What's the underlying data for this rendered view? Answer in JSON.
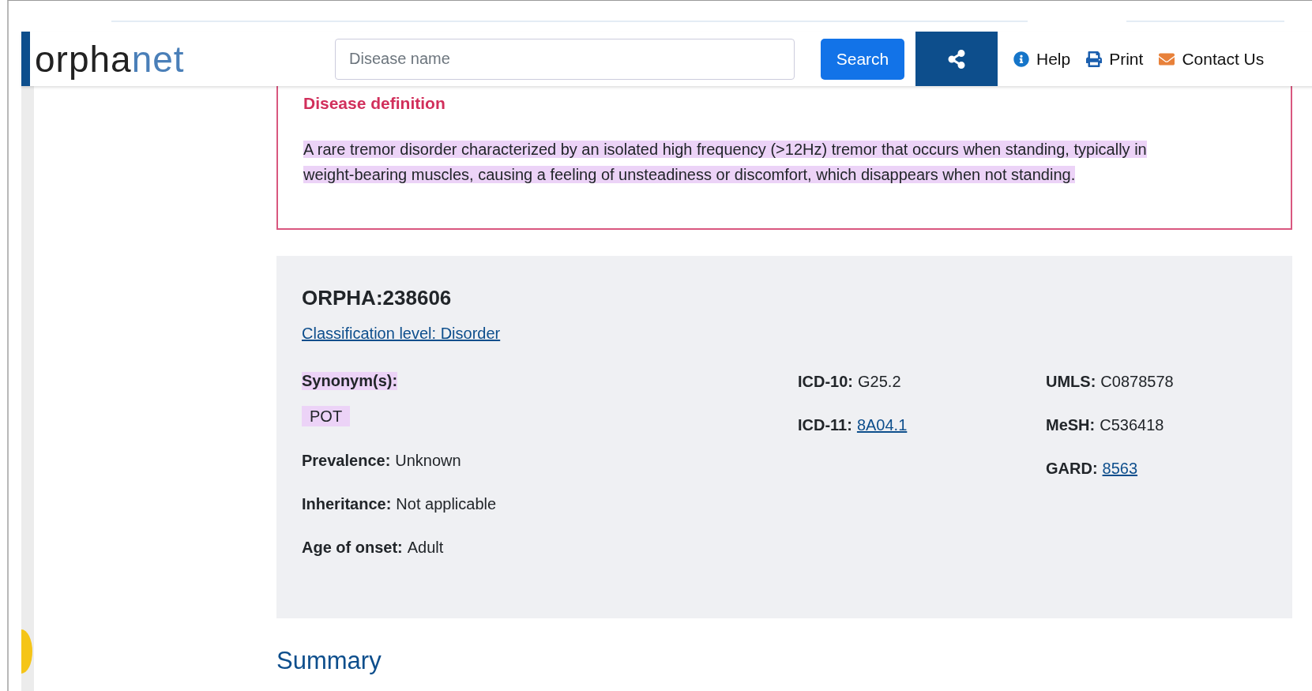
{
  "header": {
    "logo": {
      "first": "orpha",
      "second": "net"
    },
    "search": {
      "placeholder": "Disease name"
    },
    "search_button": "Search",
    "links": [
      {
        "kind": "help",
        "label": "Help"
      },
      {
        "kind": "print",
        "label": "Print"
      },
      {
        "kind": "contact",
        "label": "Contact Us"
      }
    ]
  },
  "definition": {
    "title": "Disease definition",
    "text": "A rare tremor disorder characterized by an isolated high frequency (>12Hz) tremor that occurs when standing, typically in weight-bearing muscles, causing a feeling of unsteadiness or discomfort, which disappears when not standing.",
    "highlighted": true
  },
  "record": {
    "id": "ORPHA:238606",
    "classification": "Classification level: Disorder",
    "synonyms": {
      "label": "Synonym(s):",
      "highlighted": true,
      "values": [
        {
          "text": "POT",
          "highlighted": true
        }
      ]
    },
    "fields": [
      {
        "label": "Prevalence:",
        "value": "Unknown"
      },
      {
        "label": "Inheritance:",
        "value": "Not applicable"
      },
      {
        "label": "Age of onset:",
        "value": "Adult"
      }
    ],
    "codes": [
      [
        {
          "label": "ICD-10:",
          "value": "G25.2",
          "link": false
        },
        {
          "label": "ICD-11:",
          "value": "8A04.1",
          "link": true
        }
      ],
      [
        {
          "label": "UMLS:",
          "value": "C0878578",
          "link": false
        },
        {
          "label": "MeSH:",
          "value": "C536418",
          "link": false
        },
        {
          "label": "GARD:",
          "value": "8563",
          "link": true
        }
      ]
    ]
  },
  "summary": {
    "title": "Summary"
  }
}
